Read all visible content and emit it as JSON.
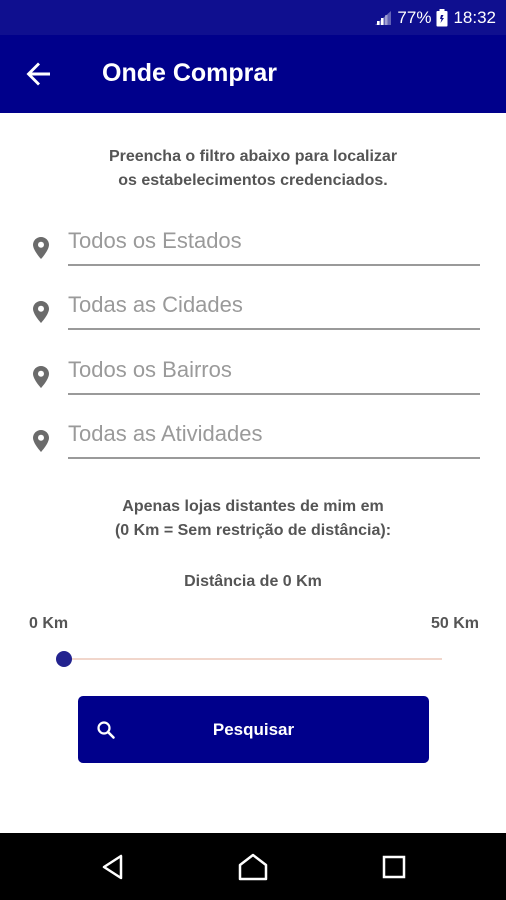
{
  "status_bar": {
    "battery": "77%",
    "time": "18:32"
  },
  "app_bar": {
    "title": "Onde Comprar"
  },
  "intro": {
    "line1": "Preencha o filtro abaixo para localizar",
    "line2": "os estabelecimentos credenciados."
  },
  "filters": {
    "state": {
      "placeholder": "Todos os Estados"
    },
    "city": {
      "placeholder": "Todas as Cidades"
    },
    "district": {
      "placeholder": "Todos os Bairros"
    },
    "activity": {
      "placeholder": "Todas as Atividades"
    }
  },
  "distance": {
    "description_line1": "Apenas lojas distantes de mim em",
    "description_line2": "(0 Km = Sem restrição de distância):",
    "current_label": "Distância de 0 Km",
    "min_label": "0 Km",
    "max_label": "50 Km",
    "value": 0,
    "min": 0,
    "max": 50
  },
  "search_button": {
    "label": "Pesquisar",
    "icon": "search-icon"
  },
  "colors": {
    "primary": "#00008b",
    "status_bar": "#0f0f8f",
    "slider_thumb": "#23238f",
    "slider_track": "#f1d6cb",
    "text_muted": "#9a9a9a",
    "text_dark": "#555555"
  },
  "icons": {
    "back": "arrow-left-icon",
    "field": "location-pin-icon",
    "nav_back": "triangle-back-icon",
    "nav_home": "home-icon",
    "nav_recent": "square-recents-icon"
  }
}
